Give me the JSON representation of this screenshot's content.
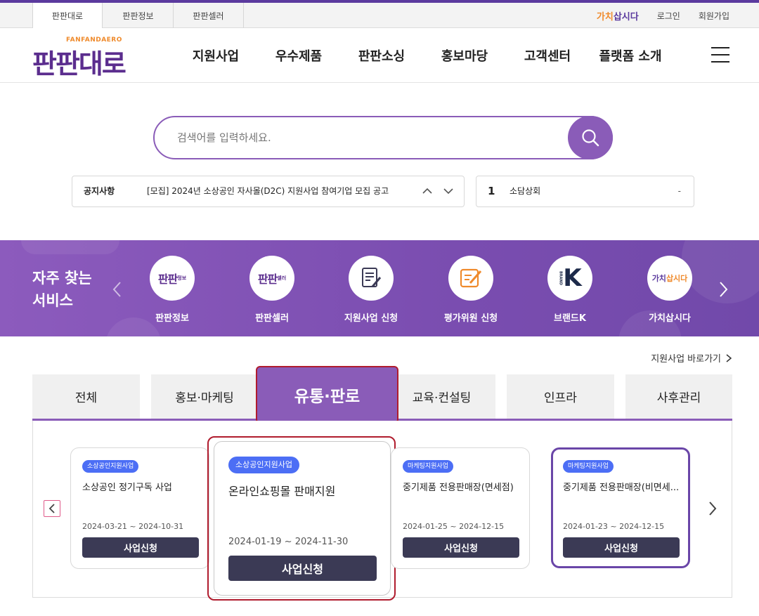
{
  "topbar": {
    "tabs": [
      "판판대로",
      "판판정보",
      "판판셀러"
    ],
    "gachi_logo": {
      "part1": "가치",
      "part2": "삽시다"
    },
    "login": "로그인",
    "signup": "회원가입"
  },
  "header": {
    "logo_small": "FANFANDAERO",
    "logo_main": "판판대로",
    "nav": [
      "지원사업",
      "우수제품",
      "판판소싱",
      "홍보마당",
      "고객센터",
      "플랫폼 소개"
    ],
    "menu_icon": "hamburger-icon"
  },
  "search": {
    "placeholder": "검색어를 입력하세요.",
    "button_icon": "search-icon"
  },
  "notice": {
    "label": "공지사항",
    "text": "[모집] 2024년 소상공인 자사몰(D2C) 지원사업 참여기업 모집 공고"
  },
  "ranking": {
    "rank": "1",
    "keyword": "소담상회",
    "change": "-"
  },
  "services": {
    "title_line1": "자주 찾는",
    "title_line2": "서비스",
    "items": [
      {
        "label": "판판정보",
        "icon": "fanfan-info-logo-icon"
      },
      {
        "label": "판판셀러",
        "icon": "fanfan-seller-logo-icon"
      },
      {
        "label": "지원사업 신청",
        "icon": "document-pen-icon"
      },
      {
        "label": "평가위원 신청",
        "icon": "edit-note-icon"
      },
      {
        "label": "브랜드K",
        "icon": "brand-k-icon"
      },
      {
        "label": "가치삽시다",
        "icon": "gachi-logo-icon"
      }
    ],
    "brandk_letter": "K",
    "brandk_side": "BRAND",
    "gachi_mark": {
      "part1": "가치",
      "part2": "삽시다"
    },
    "fanfan_info_mark": {
      "main": "판판",
      "sub": "정보"
    },
    "fanfan_seller_mark": {
      "main": "판판",
      "sub": "셀러"
    }
  },
  "shortcut": "지원사업 바로가기",
  "tabs": [
    "전체",
    "홍보·마케팅",
    "유통·판로",
    "교육·컨설팅",
    "인프라",
    "사후관리"
  ],
  "active_tab": "유통·판로",
  "cards": [
    {
      "badge": "소상공인지원사업",
      "title": "소상공인 정기구독 사업",
      "date": "2024-03-21 ~ 2024-10-31",
      "button": "사업신청"
    },
    {
      "badge": "소상공인지원사업",
      "title": "온라인쇼핑몰 판매지원",
      "date": "2024-01-19 ~ 2024-11-30",
      "button": "사업신청"
    },
    {
      "badge": "마케팅지원사업",
      "title": "중기제품 전용판매장(면세점)",
      "date": "2024-01-25 ~ 2024-12-15",
      "button": "사업신청"
    },
    {
      "badge": "마케팅지원사업",
      "title": "중기제품 전용판매장(비면세...",
      "date": "2024-01-23 ~ 2024-12-15",
      "button": "사업신청"
    }
  ],
  "colors": {
    "brand_purple": "#8a5cb8",
    "deep_purple": "#5b2d8e",
    "accent_orange": "#ef8a2b",
    "badge_blue": "#4c6ef5",
    "button_dark": "#3b3a55",
    "highlight_red": "#b01c2e"
  }
}
